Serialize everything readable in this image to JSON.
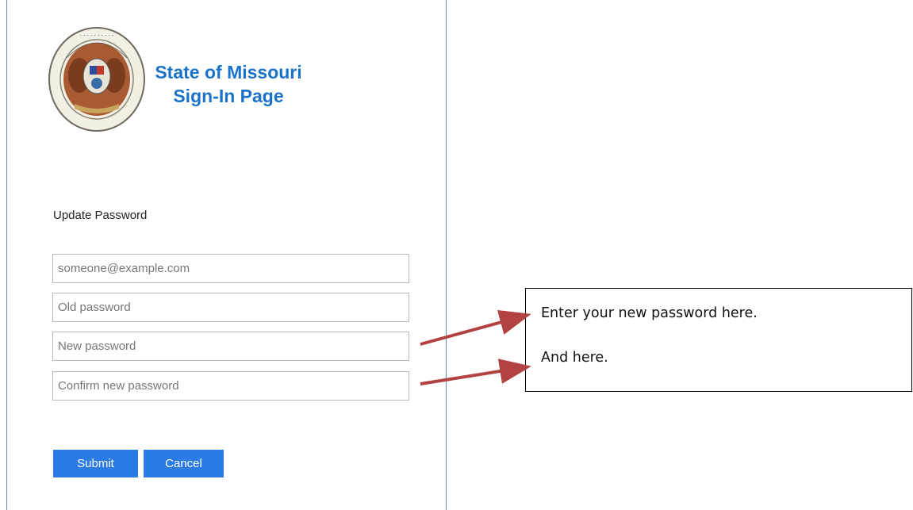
{
  "header": {
    "title_line1": "State of Missouri",
    "title_line2": "Sign-In Page",
    "seal_text": "THE GREAT SEAL OF THE STATE OF MISSOURI"
  },
  "form": {
    "heading": "Update Password",
    "email_placeholder": "someone@example.com",
    "old_password_placeholder": "Old password",
    "new_password_placeholder": "New password",
    "confirm_password_placeholder": "Confirm new password",
    "submit_label": "Submit",
    "cancel_label": "Cancel"
  },
  "callout": {
    "line1": "Enter your new password here.",
    "line2": "And here."
  },
  "colors": {
    "brand": "#1a73c9",
    "button": "#2b7be6",
    "arrow": "#b34242",
    "panel_border": "#6b8fbf"
  }
}
